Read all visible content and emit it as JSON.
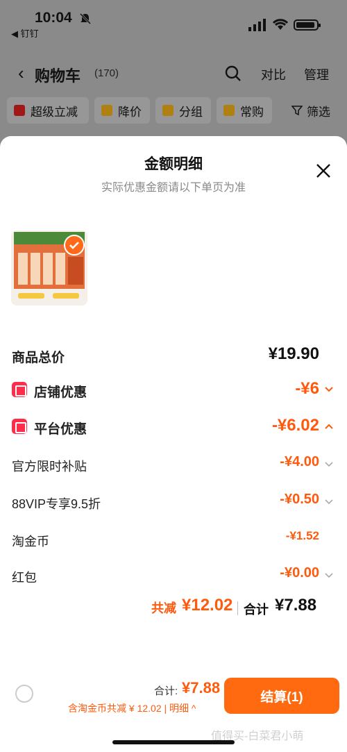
{
  "status_bar": {
    "time": "10:04",
    "back_app": "◀ 钉钉"
  },
  "header": {
    "title": "购物车",
    "count": "(170)",
    "compare": "对比",
    "manage": "管理"
  },
  "filters": [
    "超级立减",
    "降价",
    "分组",
    "常购",
    "筛选"
  ],
  "sheet": {
    "title": "金额明细",
    "subtitle": "实际优惠金额请以下单页为准",
    "rows": [
      {
        "label": "商品总价",
        "value": "¥19.90"
      },
      {
        "label": "店铺优惠",
        "value": "-¥6"
      },
      {
        "label": "平台优惠",
        "value": "-¥6.02"
      },
      {
        "label": "官方限时补贴",
        "value": "-¥4.00"
      },
      {
        "label": "88VIP专享9.5折",
        "value": "-¥0.50"
      },
      {
        "label": "淘金币",
        "value": "-¥1.52"
      },
      {
        "label": "红包",
        "value": "-¥0.00"
      }
    ],
    "summary": {
      "saved_label": "共减",
      "saved_amount": "¥12.02",
      "total_label": "合计",
      "total_amount": "¥7.88"
    }
  },
  "bottom_bar": {
    "total_label": "合计:",
    "total_amount": "¥7.88",
    "detail": "含淘金币共减 ¥ 12.02 | 明细 ^",
    "checkout": "结算(1)"
  },
  "watermark": "值得买-白菜君小萌",
  "colors": {
    "accent": "#ff5a0c",
    "badge": "#ff2d4a"
  }
}
